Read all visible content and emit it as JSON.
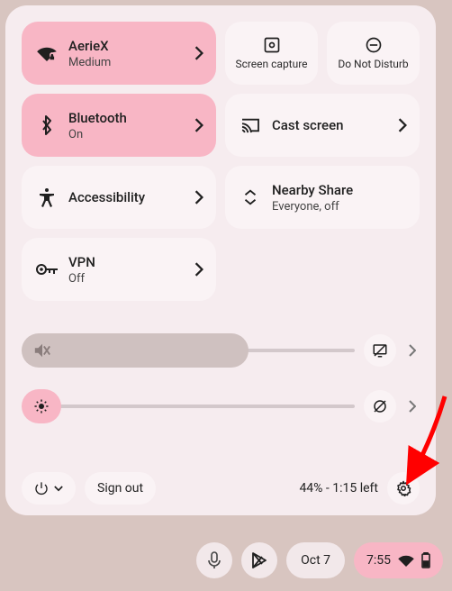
{
  "tiles": {
    "wifi": {
      "title": "AerieX",
      "subtitle": "Medium"
    },
    "screencap": {
      "label": "Screen capture"
    },
    "dnd": {
      "label": "Do Not Disturb"
    },
    "bluetooth": {
      "title": "Bluetooth",
      "subtitle": "On"
    },
    "cast": {
      "title": "Cast screen"
    },
    "accessibility": {
      "title": "Accessibility"
    },
    "nearby": {
      "title": "Nearby Share",
      "subtitle": "Everyone, off"
    },
    "vpn": {
      "title": "VPN",
      "subtitle": "Off"
    }
  },
  "bottom": {
    "signout": "Sign out",
    "battery": "44% - 1:15 left"
  },
  "shelf": {
    "date": "Oct 7",
    "time": "7:55"
  }
}
